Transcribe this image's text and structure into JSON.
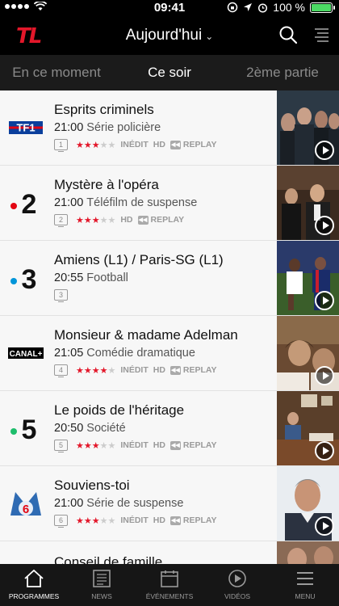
{
  "status_bar": {
    "time": "09:41",
    "battery": "100 %"
  },
  "header": {
    "logo": "TL",
    "day_selector": "Aujourd'hui"
  },
  "tabs": [
    {
      "label": "En ce moment",
      "active": false
    },
    {
      "label": "Ce soir",
      "active": true
    },
    {
      "label": "2ème partie",
      "active": false
    }
  ],
  "programs": [
    {
      "channel": "TF1",
      "channel_number": "1",
      "title": "Esprits criminels",
      "time": "21:00",
      "genre": "Série policière",
      "rating": 3,
      "inedit": "INÉDIT",
      "hd": "HD",
      "replay": "REPLAY"
    },
    {
      "channel": "France 2",
      "channel_number": "2",
      "title": "Mystère à l'opéra",
      "time": "21:00",
      "genre": "Téléfilm de suspense",
      "rating": 3,
      "inedit": "",
      "hd": "HD",
      "replay": "REPLAY"
    },
    {
      "channel": "France 3",
      "channel_number": "3",
      "title": "Amiens (L1) / Paris-SG (L1)",
      "time": "20:55",
      "genre": "Football",
      "rating": 0,
      "inedit": "",
      "hd": "",
      "replay": ""
    },
    {
      "channel": "Canal+",
      "channel_number": "4",
      "title": "Monsieur & madame Adelman",
      "time": "21:05",
      "genre": "Comédie dramatique",
      "rating": 4,
      "inedit": "INÉDIT",
      "hd": "HD",
      "replay": "REPLAY"
    },
    {
      "channel": "France 5",
      "channel_number": "5",
      "title": "Le poids de l'héritage",
      "time": "20:50",
      "genre": "Société",
      "rating": 3,
      "inedit": "INÉDIT",
      "hd": "HD",
      "replay": "REPLAY"
    },
    {
      "channel": "M6",
      "channel_number": "6",
      "title": "Souviens-toi",
      "time": "21:00",
      "genre": "Série de suspense",
      "rating": 3,
      "inedit": "INÉDIT",
      "hd": "HD",
      "replay": "REPLAY"
    }
  ],
  "next_program_peek": "Conseil de famille",
  "channel_logos": {
    "tf1": "TF1",
    "france2": "2",
    "france3": "3",
    "canal": "CANAL+",
    "france5": "5",
    "m6": "6"
  },
  "bottom_nav": [
    {
      "label": "PROGRAMMES",
      "icon": "home-icon",
      "active": true
    },
    {
      "label": "NEWS",
      "icon": "news-icon",
      "active": false
    },
    {
      "label": "ÉVÉNEMENTS",
      "icon": "calendar-icon",
      "active": false
    },
    {
      "label": "VIDÉOS",
      "icon": "play-icon",
      "active": false
    },
    {
      "label": "MENU",
      "icon": "menu-icon",
      "active": false
    }
  ],
  "colors": {
    "brand_red": "#e3172a",
    "france2_red": "#e30613",
    "france3_blue": "#0095d9",
    "france5_green": "#1dbd6b",
    "m6_blue": "#2f6bb3"
  }
}
